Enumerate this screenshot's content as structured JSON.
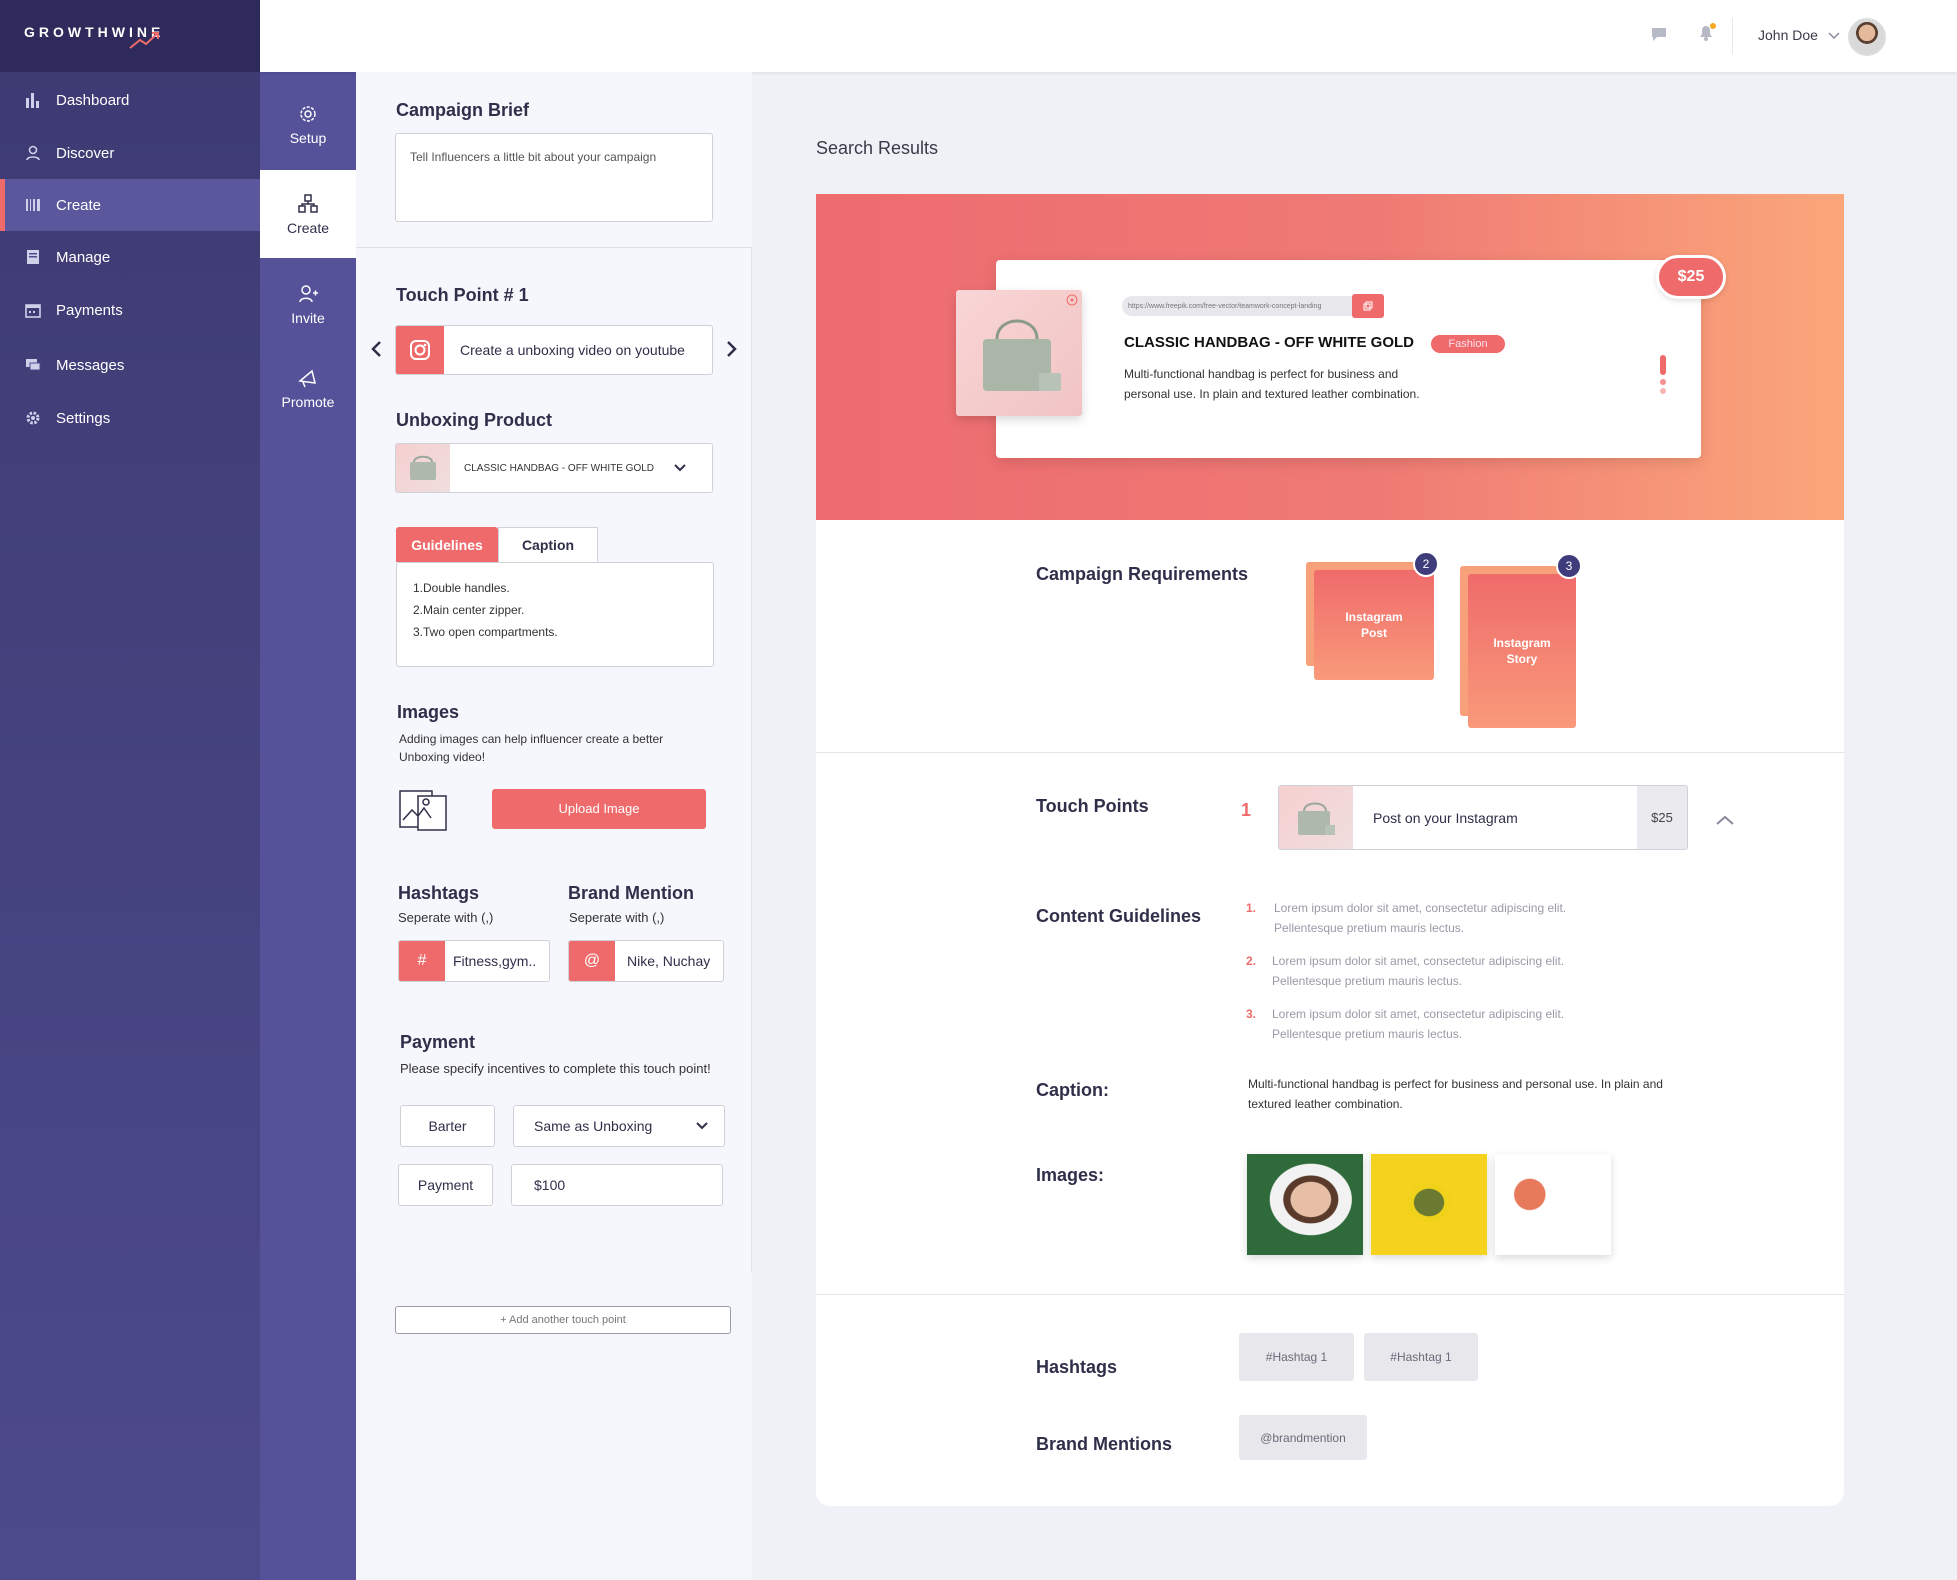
{
  "brand": {
    "logo_text": "GROWTHWINE"
  },
  "sidebar": {
    "items": [
      {
        "label": "Dashboard",
        "icon": "bar-chart-icon"
      },
      {
        "label": "Discover",
        "icon": "user-icon"
      },
      {
        "label": "Create",
        "icon": "barcode-icon",
        "active": true
      },
      {
        "label": "Manage",
        "icon": "document-icon"
      },
      {
        "label": "Payments",
        "icon": "calendar-icon"
      },
      {
        "label": "Messages",
        "icon": "chat-icon"
      },
      {
        "label": "Settings",
        "icon": "gear-icon"
      }
    ]
  },
  "subnav": {
    "items": [
      {
        "label": "Setup",
        "icon": "gear-icon"
      },
      {
        "label": "Create",
        "icon": "nodes-icon",
        "active": true
      },
      {
        "label": "Invite",
        "icon": "add-user-icon"
      },
      {
        "label": "Promote",
        "icon": "megaphone-icon"
      }
    ]
  },
  "header": {
    "user_name": "John Doe"
  },
  "form": {
    "brief_title": "Campaign Brief",
    "brief_placeholder": "Tell Influencers a little bit about your campaign",
    "touchpoint_title": "Touch Point # 1",
    "touchpoint_text": "Create a unboxing video on youtube",
    "unboxing_title": "Unboxing Product",
    "unboxing_product": "CLASSIC HANDBAG - OFF WHITE GOLD",
    "tab_guidelines": "Guidelines",
    "tab_caption": "Caption",
    "guidelines": [
      "1.Double handles.",
      "2.Main center zipper.",
      "3.Two open compartments."
    ],
    "images_title": "Images",
    "images_help": "Adding images can help influencer create a  better Unboxing video!",
    "upload_label": "Upload Image",
    "hashtags_title": "Hashtags",
    "hashtags_help": "Seperate with (,)",
    "hashtags_symbol": "#",
    "hashtags_value": "Fitness,gym..",
    "brand_title": "Brand Mention",
    "brand_help": "Seperate with (,)",
    "brand_symbol": "@",
    "brand_value": "Nike, Nuchay",
    "payment_title": "Payment",
    "payment_help": "Please specify incentives to complete this touch point!",
    "barter_label": "Barter",
    "barter_select": "Same as Unboxing",
    "payment_label": "Payment",
    "payment_value": "$100",
    "add_touchpoint": "+ Add another touch point"
  },
  "results": {
    "title": "Search Results",
    "product": {
      "url": "https://www.freepik.com/free-vector/teamwork-concept-landing",
      "name": "CLASSIC HANDBAG - OFF WHITE GOLD",
      "category": "Fashion",
      "description_line1": "Multi-functional handbag is perfect for business and",
      "description_line2": "personal use. In plain and textured leather combination.",
      "price": "$25"
    },
    "requirements_label": "Campaign Requirements",
    "requirements": [
      {
        "line1": "Instagram",
        "line2": "Post",
        "count": "2"
      },
      {
        "line1": "Instagram",
        "line2": "Story",
        "count": "3"
      }
    ],
    "touchpoints_label": "Touch Points",
    "touchpoint_index": "1",
    "touchpoint_text": "Post on your Instagram",
    "touchpoint_price": "$25",
    "guidelines_label": "Content Guidelines",
    "guidelines": [
      {
        "num": "1.",
        "line1": "Lorem ipsum dolor sit amet, consectetur adipiscing elit.",
        "line2": "Pellentesque pretium mauris lectus."
      },
      {
        "num": "2.",
        "line1": "Lorem ipsum dolor sit amet, consectetur adipiscing elit.",
        "line2": "Pellentesque pretium mauris lectus."
      },
      {
        "num": "3.",
        "line1": "Lorem ipsum dolor sit amet, consectetur adipiscing elit.",
        "line2": "Pellentesque pretium mauris lectus."
      }
    ],
    "caption_label": "Caption:",
    "caption_line1": "Multi-functional handbag is perfect for business and personal use. In plain and",
    "caption_line2": "textured leather combination.",
    "images_label": "Images:",
    "hashtags_label": "Hashtags",
    "hashtags": [
      "#Hashtag 1",
      "#Hashtag 1"
    ],
    "brand_label": "Brand Mentions",
    "brand_mentions": [
      "@brandmention"
    ]
  },
  "colors": {
    "accent": "#ef6b6b",
    "sidebar": "#3d3a72",
    "badge": "#3f3c7c"
  }
}
